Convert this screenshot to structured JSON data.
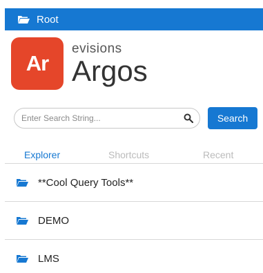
{
  "header": {
    "title": "Root",
    "icon": "open-folder-icon"
  },
  "logo": {
    "badge_text": "Ar",
    "vendor": "evisions",
    "product": "Argos",
    "badge_color": "#e5462a"
  },
  "search": {
    "placeholder": "Enter Search String...",
    "value": "",
    "button_label": "Search",
    "icon": "search-icon"
  },
  "tabs": [
    {
      "label": "Explorer",
      "active": true
    },
    {
      "label": "Shortcuts",
      "active": false
    },
    {
      "label": "Recent",
      "active": false
    }
  ],
  "items": [
    {
      "label": "**Cool Query Tools**",
      "icon": "open-folder-icon"
    },
    {
      "label": "DEMO",
      "icon": "open-folder-icon"
    },
    {
      "label": "LMS",
      "icon": "open-folder-icon"
    }
  ],
  "colors": {
    "accent": "#1678d2",
    "brand": "#e5462a",
    "inactive_tab": "#bbbbbb"
  }
}
